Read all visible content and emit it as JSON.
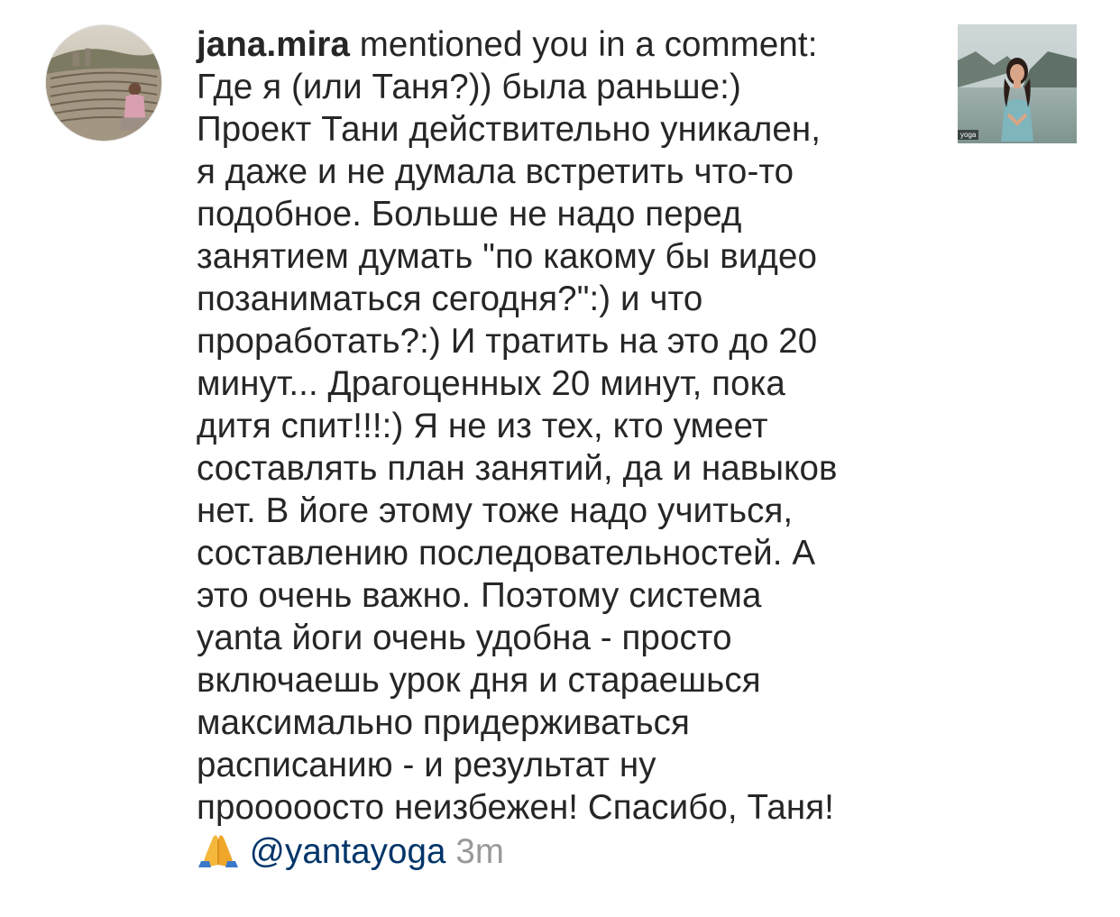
{
  "notification": {
    "username": "jana.mira",
    "action_text": " mentioned you in a comment:",
    "comment_lines": [
      "Где я (или Таня?)) была раньше:)",
      "Проект Тани действительно уникален,",
      "я даже и не думала встретить что-то",
      "подобное. Больше не надо перед",
      "занятием думать \"по какому бы видео",
      "позаниматься сегодня?\":) и что",
      "проработать?:) И тратить на это до 20",
      "минут... Драгоценных 20 минут, пока",
      "дитя спит!!!:) Я не из тех, кто умеет",
      "составлять план занятий, да и навыков",
      "нет. В йоге этому тоже надо учиться,",
      "составлению последовательностей. А",
      "это очень важно. Поэтому система",
      "yanta йоги очень удобна - просто",
      "включаешь урок дня и стараешься",
      "максимально придерживаться",
      "расписанию - и результат ну",
      "прооооосто неизбежен! Спасибо, Таня!"
    ],
    "emoji": "🙏",
    "mention": "@yantayoga",
    "timestamp": "3m",
    "thumbnail_tag": "yoga"
  },
  "icons": {
    "emoji_icon": "folded-hands-icon"
  },
  "colors": {
    "text": "#262626",
    "mention": "#003569",
    "timestamp": "#999999"
  }
}
